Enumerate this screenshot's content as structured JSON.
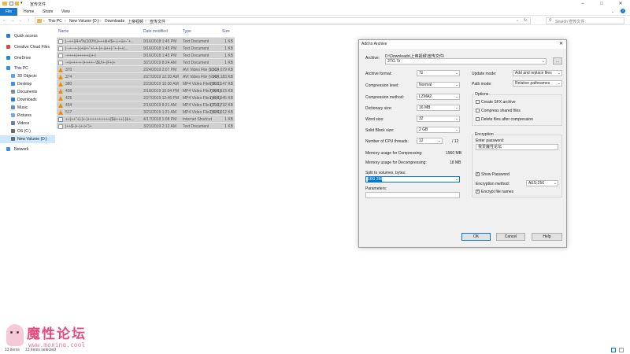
{
  "window": {
    "title": "宣传文件",
    "controls": [
      "–",
      "□",
      "✕"
    ]
  },
  "ribbon": {
    "tabs": [
      "File",
      "Home",
      "Share",
      "View"
    ]
  },
  "address": {
    "path": [
      "This PC",
      "New Volume (D:)",
      "Downloads",
      "上帝视频",
      "宣传文件"
    ],
    "search_placeholder": "Search 宣传文件"
  },
  "navpane": {
    "items": [
      {
        "label": "Quick access",
        "icon": "star-icon",
        "color": "#2b7bd1"
      },
      {
        "label": "Creative Cloud Files",
        "icon": "cloud-icon",
        "color": "#d84a36"
      },
      {
        "label": "OneDrive",
        "icon": "onedrive-icon",
        "color": "#1e88e5"
      },
      {
        "label": "This PC",
        "icon": "computer-icon",
        "color": "#3a8ee6"
      },
      {
        "label": "3D Objects",
        "icon": "cube-icon",
        "color": "#5ba4e6"
      },
      {
        "label": "Desktop",
        "icon": "desktop-icon",
        "color": "#3d8fe0"
      },
      {
        "label": "Documents",
        "icon": "documents-icon",
        "color": "#7d8a99"
      },
      {
        "label": "Downloads",
        "icon": "download-icon",
        "color": "#2a7bd3"
      },
      {
        "label": "Music",
        "icon": "music-icon",
        "color": "#5b8fd1"
      },
      {
        "label": "Pictures",
        "icon": "pictures-icon",
        "color": "#7aa6d8"
      },
      {
        "label": "Videos",
        "icon": "videos-icon",
        "color": "#6d7da8"
      },
      {
        "label": "OS (C:)",
        "icon": "drive-icon",
        "color": "#6b6b6b"
      },
      {
        "label": "New Volume (D:)",
        "icon": "drive-icon",
        "color": "#6b6b6b"
      },
      {
        "label": "Network",
        "icon": "network-icon",
        "color": "#3d8fe0"
      }
    ]
  },
  "filelist": {
    "columns": [
      "Name",
      "Date modified",
      "Type",
      "Size"
    ],
    "rows": [
      {
        "name": "|--++|(4+/%(100%)+++Ⅲ+l$+-|-+ⅲ+-\"+..",
        "date": "9/16/2018 1:45 PM",
        "type": "Text Document",
        "size": "1 KB",
        "icon": "text"
      },
      {
        "name": "|--+--+-|-|+ⅲ+-\"+\\-+-|+-ⅲ++|-\"+-|++|...",
        "date": "9/16/2018 1:45 PM",
        "type": "Text Document",
        "size": "1 KB",
        "icon": "text"
      },
      {
        "name": "-++++|+++++ⅱ|+-|",
        "date": "9/16/2018 1:45 PM",
        "type": "Text Document",
        "size": "1 KB",
        "icon": "text"
      },
      {
        "name": "-+ⅱ+++-+-|++++--\\$U\\+-|F+|+",
        "date": "3/21/2019 8:24 AM",
        "type": "Text Document",
        "size": "1 KB",
        "icon": "text"
      },
      {
        "name": "370",
        "date": "2/24/2019 2:07 PM",
        "type": "AVI Video File (VLC)",
        "size": "1,514,079 KB",
        "icon": "vlc"
      },
      {
        "name": "374",
        "date": "2/27/2019 12:20 AM",
        "type": "AVI Video File (VLC)",
        "size": "994,183 KB",
        "icon": "vlc"
      },
      {
        "name": "380",
        "date": "2/23/2019 10:30 AM",
        "type": "MP4 Video File (VLC)",
        "size": "6,916,147 KB",
        "icon": "vlc"
      },
      {
        "name": "408",
        "date": "2/18/2019 10:04 PM",
        "type": "MP4 Video File (VLC)",
        "size": "7,094,923 KB",
        "icon": "vlc"
      },
      {
        "name": "425",
        "date": "2/27/2019 12:46 PM",
        "type": "MP4 Video File (VLC)",
        "size": "1,464,045 KB",
        "icon": "vlc"
      },
      {
        "name": "454",
        "date": "2/16/2019 8:21 AM",
        "type": "MP4 Video File (VLC)",
        "size": "1,719,732 KB",
        "icon": "vlc"
      },
      {
        "name": "517",
        "date": "3/21/2019 1:21 AM",
        "type": "MP4 Video File (VLC)",
        "size": "2,624,012 KB",
        "icon": "vlc"
      },
      {
        "name": "++|++\"+|-|+-|++++++++++|$ⅲ+++|-|ⅲ+...",
        "date": "4/17/2018 1:08 PM",
        "type": "Internet Shortcut",
        "size": "1 KB",
        "icon": "shortcut"
      },
      {
        "name": "|++$-|+-|+-|+\"|+",
        "date": "3/21/2019 2:12 AM",
        "type": "Text Document",
        "size": "1 KB",
        "icon": "text"
      }
    ]
  },
  "dialog": {
    "title": "Add to Archive",
    "archive_label": "Archive:",
    "archive_path": "D:\\Downloads\\上帝视频\\宣传文件\\",
    "archive_name": "2TG.7z",
    "browse_label": "...",
    "left_fields": [
      {
        "label": "Archive format:",
        "value": "7z"
      },
      {
        "label": "Compression level:",
        "value": "Normal"
      },
      {
        "label": "Compression method:",
        "value": "LZMA2"
      },
      {
        "label": "Dictionary size:",
        "value": "16 MB"
      },
      {
        "label": "Word size:",
        "value": "32"
      },
      {
        "label": "Solid Block size:",
        "value": "2 GB"
      }
    ],
    "cpu_label": "Number of CPU threads:",
    "cpu_value": "12",
    "cpu_max": "/ 12",
    "mem_compress_label": "Memory usage for Compressing:",
    "mem_compress_value": "1960 MB",
    "mem_decompress_label": "Memory usage for Decompressing:",
    "mem_decompress_value": "18 MB",
    "split_label": "Split to volumes, bytes:",
    "split_value": "10G 2M",
    "params_label": "Parameters:",
    "params_value": "",
    "update_label": "Update mode:",
    "update_value": "Add and replace files",
    "pathmode_label": "Path mode:",
    "pathmode_value": "Relative pathnames",
    "options_label": "Options",
    "options": [
      {
        "label": "Create SFX archive",
        "checked": false
      },
      {
        "label": "Compress shared files",
        "checked": false
      },
      {
        "label": "Delete files after compression",
        "checked": false
      }
    ],
    "encryption_label": "Encryption",
    "password_label": "Enter password:",
    "password_value": "我爱魔性论坛",
    "show_password_label": "Show Password",
    "enc_method_label": "Encryption method:",
    "enc_method_value": "AES-256",
    "encrypt_names_label": "Encrypt file names",
    "ok_label": "OK",
    "cancel_label": "Cancel",
    "help_label": "Help"
  },
  "status": {
    "items": "13 items",
    "selected": "13 items selected"
  },
  "watermark": {
    "title": "魔性论坛",
    "url": "www.moxing.cool"
  }
}
